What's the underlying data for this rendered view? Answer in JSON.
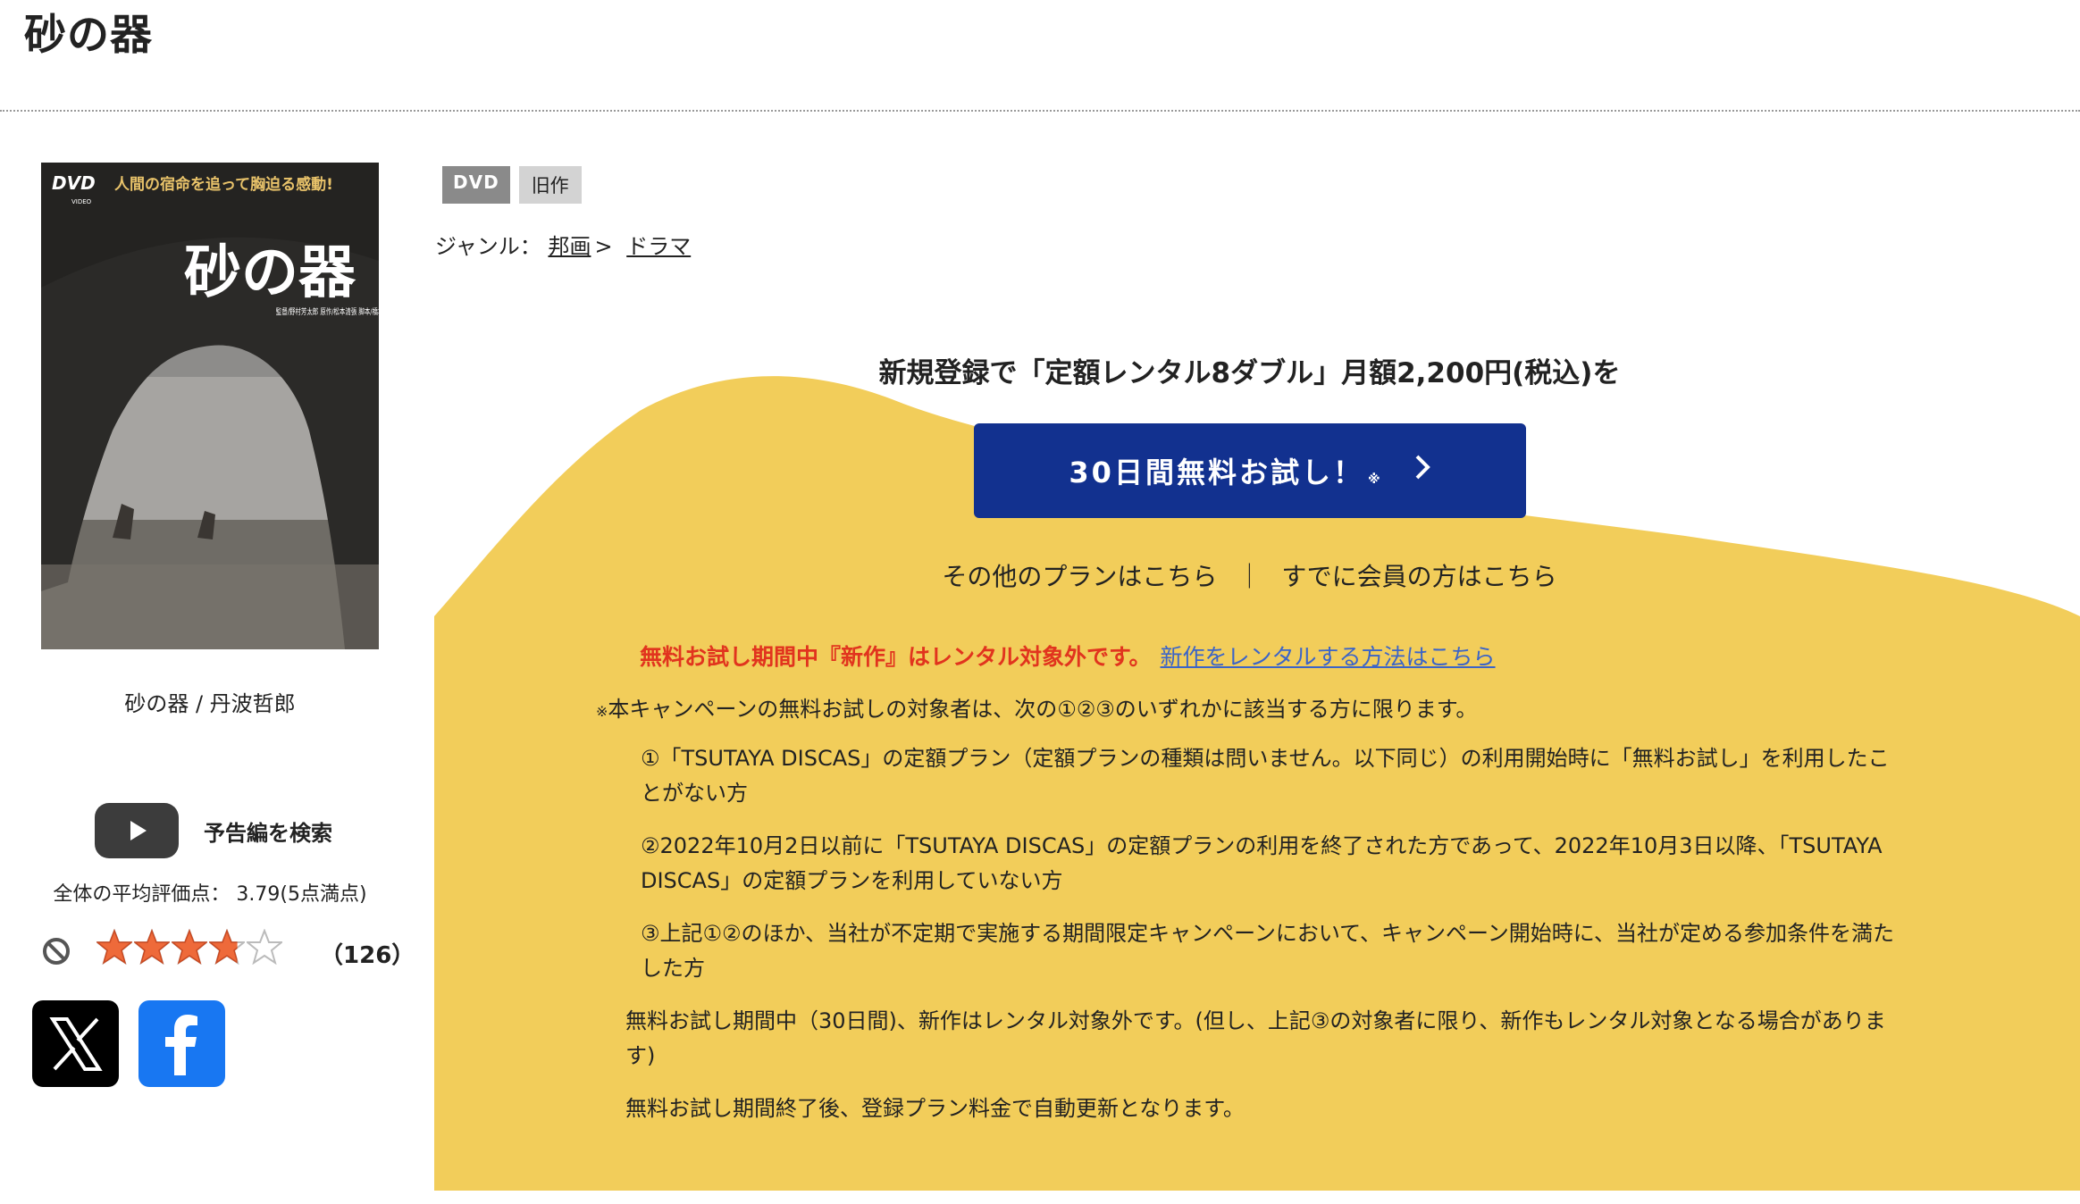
{
  "title": "砂の器",
  "cover": {
    "dvd_logo": "DVD",
    "dvd_sub": "VIDEO",
    "tagline": "人間の宿命を追って胸迫る感動!",
    "title_art": "砂の器",
    "credits": "監督/野村芳太郎 原作/松本清張 脚本/橋本忍 山田洋次"
  },
  "caption": "砂の器 / 丹波哲郎",
  "trailer": {
    "icon": "youtube-play-icon",
    "label": "予告編を検索"
  },
  "rating": {
    "average_text": "全体の平均評価点： 3.79(5点満点)",
    "value": 3.79,
    "max": 5,
    "count_open": "（",
    "count": "126",
    "count_close": "）"
  },
  "share": {
    "x_icon": "x-logo-icon",
    "facebook_icon": "facebook-logo-icon"
  },
  "tags": [
    "DVD",
    "旧作"
  ],
  "genre": {
    "label": "ジャンル：",
    "level1": "邦画",
    "separator": ">",
    "level2": "ドラマ"
  },
  "campaign": {
    "headline": "新規登録で「定額レンタル8ダブル」月額2,200円(税込)を",
    "button_label": "30日間無料お試し！",
    "button_note": "※",
    "other_plans": "その他のプランはこちら",
    "separator": "｜",
    "members": "すでに会員の方はこちら",
    "warning_red": "無料お試し期間中『新作』はレンタル対象外です。",
    "warning_link": "新作をレンタルする方法はこちら",
    "note_mark": "※",
    "note_intro": "本キャンペーンの無料お試しの対象者は、次の①②③のいずれかに該当する方に限ります。",
    "conditions": [
      "①「TSUTAYA DISCAS」の定額プラン（定額プランの種類は問いません。以下同じ）の利用開始時に「無料お試し」を利用したことがない方",
      "②2022年10月2日以前に「TSUTAYA DISCAS」の定額プランの利用を終了された方であって、2022年10月3日以降、「TSUTAYA DISCAS」の定額プランを利用していない方",
      "③上記①②のほか、当社が不定期で実施する期間限定キャンペーンにおいて、キャンペーン開始時に、当社が定める参加条件を満たした方"
    ],
    "notes": [
      "無料お試し期間中（30日間)、新作はレンタル対象外です。(但し、上記③の対象者に限り、新作もレンタル対象となる場合があります)",
      "無料お試し期間終了後、登録プラン料金で自動更新となります。"
    ]
  },
  "colors": {
    "campaign_yellow": "#f2cd5a",
    "button_blue": "#12318f",
    "warning_red": "#e1341e",
    "link_blue": "#3b64c8",
    "star_orange": "#ee6a3a"
  }
}
